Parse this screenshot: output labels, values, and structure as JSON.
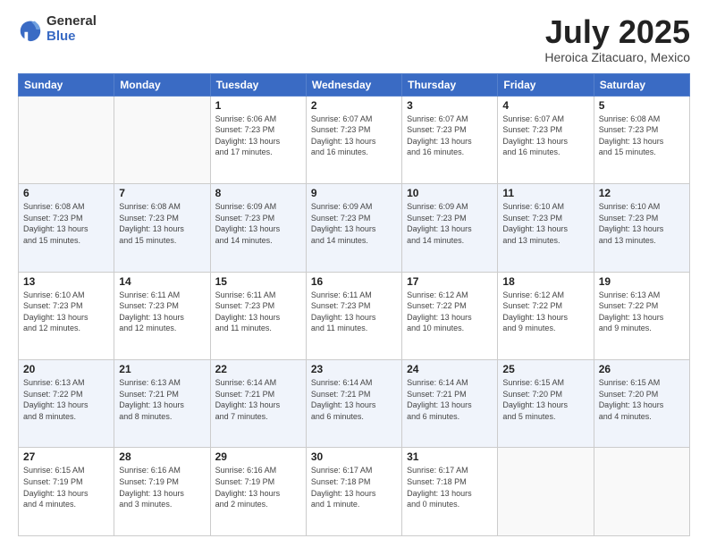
{
  "logo": {
    "general": "General",
    "blue": "Blue"
  },
  "title": "July 2025",
  "subtitle": "Heroica Zitacuaro, Mexico",
  "headers": [
    "Sunday",
    "Monday",
    "Tuesday",
    "Wednesday",
    "Thursday",
    "Friday",
    "Saturday"
  ],
  "weeks": [
    [
      {
        "day": "",
        "info": ""
      },
      {
        "day": "",
        "info": ""
      },
      {
        "day": "1",
        "info": "Sunrise: 6:06 AM\nSunset: 7:23 PM\nDaylight: 13 hours\nand 17 minutes."
      },
      {
        "day": "2",
        "info": "Sunrise: 6:07 AM\nSunset: 7:23 PM\nDaylight: 13 hours\nand 16 minutes."
      },
      {
        "day": "3",
        "info": "Sunrise: 6:07 AM\nSunset: 7:23 PM\nDaylight: 13 hours\nand 16 minutes."
      },
      {
        "day": "4",
        "info": "Sunrise: 6:07 AM\nSunset: 7:23 PM\nDaylight: 13 hours\nand 16 minutes."
      },
      {
        "day": "5",
        "info": "Sunrise: 6:08 AM\nSunset: 7:23 PM\nDaylight: 13 hours\nand 15 minutes."
      }
    ],
    [
      {
        "day": "6",
        "info": "Sunrise: 6:08 AM\nSunset: 7:23 PM\nDaylight: 13 hours\nand 15 minutes."
      },
      {
        "day": "7",
        "info": "Sunrise: 6:08 AM\nSunset: 7:23 PM\nDaylight: 13 hours\nand 15 minutes."
      },
      {
        "day": "8",
        "info": "Sunrise: 6:09 AM\nSunset: 7:23 PM\nDaylight: 13 hours\nand 14 minutes."
      },
      {
        "day": "9",
        "info": "Sunrise: 6:09 AM\nSunset: 7:23 PM\nDaylight: 13 hours\nand 14 minutes."
      },
      {
        "day": "10",
        "info": "Sunrise: 6:09 AM\nSunset: 7:23 PM\nDaylight: 13 hours\nand 14 minutes."
      },
      {
        "day": "11",
        "info": "Sunrise: 6:10 AM\nSunset: 7:23 PM\nDaylight: 13 hours\nand 13 minutes."
      },
      {
        "day": "12",
        "info": "Sunrise: 6:10 AM\nSunset: 7:23 PM\nDaylight: 13 hours\nand 13 minutes."
      }
    ],
    [
      {
        "day": "13",
        "info": "Sunrise: 6:10 AM\nSunset: 7:23 PM\nDaylight: 13 hours\nand 12 minutes."
      },
      {
        "day": "14",
        "info": "Sunrise: 6:11 AM\nSunset: 7:23 PM\nDaylight: 13 hours\nand 12 minutes."
      },
      {
        "day": "15",
        "info": "Sunrise: 6:11 AM\nSunset: 7:23 PM\nDaylight: 13 hours\nand 11 minutes."
      },
      {
        "day": "16",
        "info": "Sunrise: 6:11 AM\nSunset: 7:23 PM\nDaylight: 13 hours\nand 11 minutes."
      },
      {
        "day": "17",
        "info": "Sunrise: 6:12 AM\nSunset: 7:22 PM\nDaylight: 13 hours\nand 10 minutes."
      },
      {
        "day": "18",
        "info": "Sunrise: 6:12 AM\nSunset: 7:22 PM\nDaylight: 13 hours\nand 9 minutes."
      },
      {
        "day": "19",
        "info": "Sunrise: 6:13 AM\nSunset: 7:22 PM\nDaylight: 13 hours\nand 9 minutes."
      }
    ],
    [
      {
        "day": "20",
        "info": "Sunrise: 6:13 AM\nSunset: 7:22 PM\nDaylight: 13 hours\nand 8 minutes."
      },
      {
        "day": "21",
        "info": "Sunrise: 6:13 AM\nSunset: 7:21 PM\nDaylight: 13 hours\nand 8 minutes."
      },
      {
        "day": "22",
        "info": "Sunrise: 6:14 AM\nSunset: 7:21 PM\nDaylight: 13 hours\nand 7 minutes."
      },
      {
        "day": "23",
        "info": "Sunrise: 6:14 AM\nSunset: 7:21 PM\nDaylight: 13 hours\nand 6 minutes."
      },
      {
        "day": "24",
        "info": "Sunrise: 6:14 AM\nSunset: 7:21 PM\nDaylight: 13 hours\nand 6 minutes."
      },
      {
        "day": "25",
        "info": "Sunrise: 6:15 AM\nSunset: 7:20 PM\nDaylight: 13 hours\nand 5 minutes."
      },
      {
        "day": "26",
        "info": "Sunrise: 6:15 AM\nSunset: 7:20 PM\nDaylight: 13 hours\nand 4 minutes."
      }
    ],
    [
      {
        "day": "27",
        "info": "Sunrise: 6:15 AM\nSunset: 7:19 PM\nDaylight: 13 hours\nand 4 minutes."
      },
      {
        "day": "28",
        "info": "Sunrise: 6:16 AM\nSunset: 7:19 PM\nDaylight: 13 hours\nand 3 minutes."
      },
      {
        "day": "29",
        "info": "Sunrise: 6:16 AM\nSunset: 7:19 PM\nDaylight: 13 hours\nand 2 minutes."
      },
      {
        "day": "30",
        "info": "Sunrise: 6:17 AM\nSunset: 7:18 PM\nDaylight: 13 hours\nand 1 minute."
      },
      {
        "day": "31",
        "info": "Sunrise: 6:17 AM\nSunset: 7:18 PM\nDaylight: 13 hours\nand 0 minutes."
      },
      {
        "day": "",
        "info": ""
      },
      {
        "day": "",
        "info": ""
      }
    ]
  ]
}
